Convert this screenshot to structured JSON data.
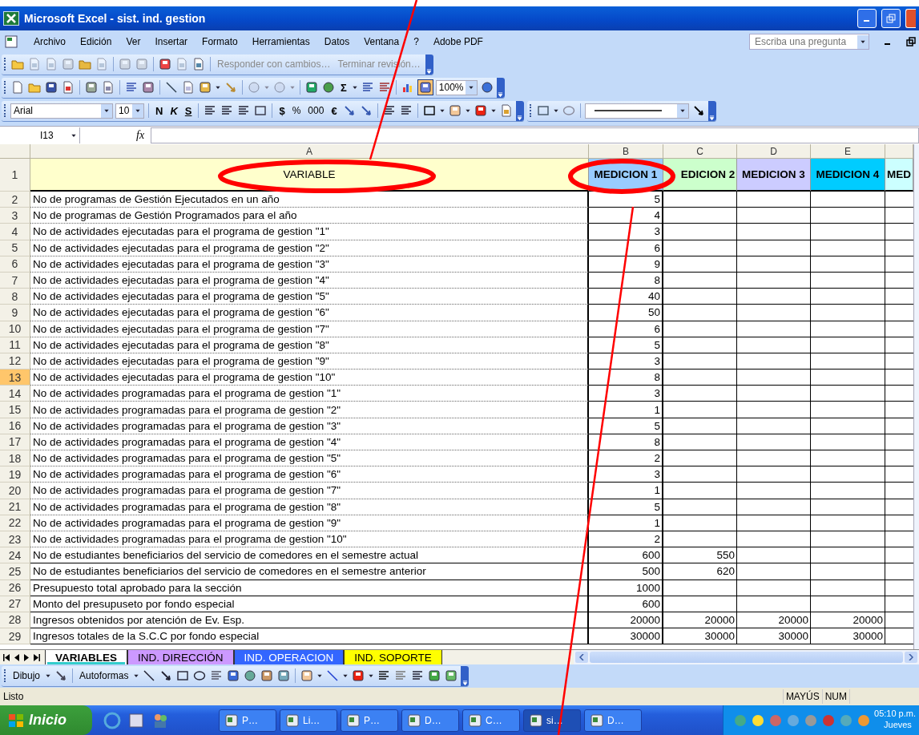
{
  "window": {
    "title": "Microsoft Excel - sist. ind. gestion"
  },
  "menu": [
    "Archivo",
    "Edición",
    "Ver",
    "Insertar",
    "Formato",
    "Herramientas",
    "Datos",
    "Ventana",
    "?",
    "Adobe PDF"
  ],
  "help_search": {
    "placeholder": "Escriba una pregunta"
  },
  "review_toolbar": {
    "reply": "Responder con cambios…",
    "end_review": "Terminar revisión…"
  },
  "standard_toolbar": {
    "autosum": "Σ",
    "zoom": "100%"
  },
  "formatting_toolbar": {
    "font": "Arial",
    "size": "10",
    "bold": "N",
    "italic": "K",
    "underline": "S",
    "currency": "$",
    "percent": "%",
    "thousands": "000",
    "euro": "€"
  },
  "name_box": "I13",
  "function_label": "fx",
  "header_row_number": "1",
  "columns": [
    {
      "letter": "A",
      "heading": "VARIABLE",
      "color": "#ffffcc"
    },
    {
      "letter": "B",
      "heading": "MEDICION 1",
      "color": "#99ccff"
    },
    {
      "letter": "C",
      "heading": "EDICION 2",
      "color": "#ccffcc"
    },
    {
      "letter": "D",
      "heading": "MEDICION 3",
      "color": "#ccccff"
    },
    {
      "letter": "E",
      "heading": "MEDICION 4",
      "color": "#00ccff"
    },
    {
      "heading": "MED",
      "color": "#ccffff"
    }
  ],
  "rows": [
    {
      "number": "2",
      "variable": "No de programas de Gestión Ejecutados en un año",
      "values": [
        "5"
      ],
      "selected": false
    },
    {
      "number": "3",
      "variable": "No de programas de Gestión Programados para el año",
      "values": [
        "4"
      ],
      "selected": false
    },
    {
      "number": "4",
      "variable": "No de actividades ejecutadas para el programa de gestion \"1\"",
      "values": [
        "3"
      ],
      "selected": false
    },
    {
      "number": "5",
      "variable": "No de actividades ejecutadas para el programa de gestion \"2\"",
      "values": [
        "6"
      ],
      "selected": false
    },
    {
      "number": "6",
      "variable": "No de actividades ejecutadas para el programa de gestion \"3\"",
      "values": [
        "9"
      ],
      "selected": false
    },
    {
      "number": "7",
      "variable": "No de actividades ejecutadas para el programa de gestion \"4\"",
      "values": [
        "8"
      ],
      "selected": false
    },
    {
      "number": "8",
      "variable": "No de actividades ejecutadas para el programa de gestion \"5\"",
      "values": [
        "40"
      ],
      "selected": false
    },
    {
      "number": "9",
      "variable": "No de actividades ejecutadas para el programa de gestion \"6\"",
      "values": [
        "50"
      ],
      "selected": false
    },
    {
      "number": "10",
      "variable": "No de actividades ejecutadas para el programa de gestion \"7\"",
      "values": [
        "6"
      ],
      "selected": false
    },
    {
      "number": "11",
      "variable": "No de actividades ejecutadas para el programa de gestion \"8\"",
      "values": [
        "5"
      ],
      "selected": false
    },
    {
      "number": "12",
      "variable": "No de actividades ejecutadas para el programa de gestion \"9\"",
      "values": [
        "3"
      ],
      "selected": false
    },
    {
      "number": "13",
      "variable": "No de actividades ejecutadas para el programa de gestion \"10\"",
      "values": [
        "8"
      ],
      "selected": true
    },
    {
      "number": "14",
      "variable": "No de actividades programadas para el programa de gestion \"1\"",
      "values": [
        "3"
      ],
      "selected": false
    },
    {
      "number": "15",
      "variable": "No de actividades programadas para el programa de gestion \"2\"",
      "values": [
        "1"
      ],
      "selected": false
    },
    {
      "number": "16",
      "variable": "No de actividades programadas para el programa de gestion \"3\"",
      "values": [
        "5"
      ],
      "selected": false
    },
    {
      "number": "17",
      "variable": "No de actividades programadas para el programa de gestion \"4\"",
      "values": [
        "8"
      ],
      "selected": false
    },
    {
      "number": "18",
      "variable": "No de actividades programadas para el programa de gestion \"5\"",
      "values": [
        "2"
      ],
      "selected": false
    },
    {
      "number": "19",
      "variable": "No de actividades programadas para el programa de gestion \"6\"",
      "values": [
        "3"
      ],
      "selected": false
    },
    {
      "number": "20",
      "variable": "No de actividades programadas para el programa de gestion \"7\"",
      "values": [
        "1"
      ],
      "selected": false
    },
    {
      "number": "21",
      "variable": "No de actividades programadas para el programa de gestion \"8\"",
      "values": [
        "5"
      ],
      "selected": false
    },
    {
      "number": "22",
      "variable": "No de actividades programadas para el programa de gestion \"9\"",
      "values": [
        "1"
      ],
      "selected": false
    },
    {
      "number": "23",
      "variable": "No de actividades programadas para el programa de gestion \"10\"",
      "values": [
        "2"
      ],
      "selected": false
    },
    {
      "number": "24",
      "variable": "No de estudiantes beneficiarios del servicio de comedores en el semestre actual",
      "values": [
        "600",
        "550"
      ],
      "selected": false
    },
    {
      "number": "25",
      "variable": "No de estudiantes beneficiarios del servicio de comedores en el semestre anterior",
      "values": [
        "500",
        "620"
      ],
      "selected": false
    },
    {
      "number": "26",
      "variable": "Presupuesto total aprobado para la sección",
      "values": [
        "1000"
      ],
      "selected": false
    },
    {
      "number": "27",
      "variable": "Monto del presupuseto por fondo especial",
      "values": [
        "600"
      ],
      "selected": false
    },
    {
      "number": "28",
      "variable": "Ingresos obtenidos por atención de Ev. Esp.",
      "values": [
        "20000",
        "20000",
        "20000",
        "20000"
      ],
      "selected": false
    },
    {
      "number": "29",
      "variable": "Ingresos totales de la S.C.C por fondo especial",
      "values": [
        "30000",
        "30000",
        "30000",
        "30000"
      ],
      "selected": false
    }
  ],
  "sheet_tabs": [
    {
      "label": "VARIABLES",
      "selected": true,
      "color": "#33cccc"
    },
    {
      "label": "IND. DIRECCIÓN",
      "selected": false,
      "color": "#cc99ff"
    },
    {
      "label": "IND. OPERACION",
      "selected": false,
      "color": "#3366ff"
    },
    {
      "label": "IND. SOPORTE",
      "selected": false,
      "color": "#ffff00"
    }
  ],
  "drawing_toolbar": {
    "draw": "Dibujo",
    "autoshapes": "Autoformas"
  },
  "status_bar": {
    "status": "Listo",
    "indicators": [
      "MAYÚS",
      "NUM"
    ]
  },
  "taskbar": {
    "start": "Inicio",
    "buttons": [
      {
        "label": "P…",
        "selected": false
      },
      {
        "label": "Li…",
        "selected": false
      },
      {
        "label": "P…",
        "selected": false
      },
      {
        "label": "D…",
        "selected": false
      },
      {
        "label": "C…",
        "selected": false
      },
      {
        "label": "si…",
        "selected": true
      },
      {
        "label": "D…",
        "selected": false
      }
    ],
    "clock": "05:10 p.m.",
    "day": "Jueves"
  }
}
